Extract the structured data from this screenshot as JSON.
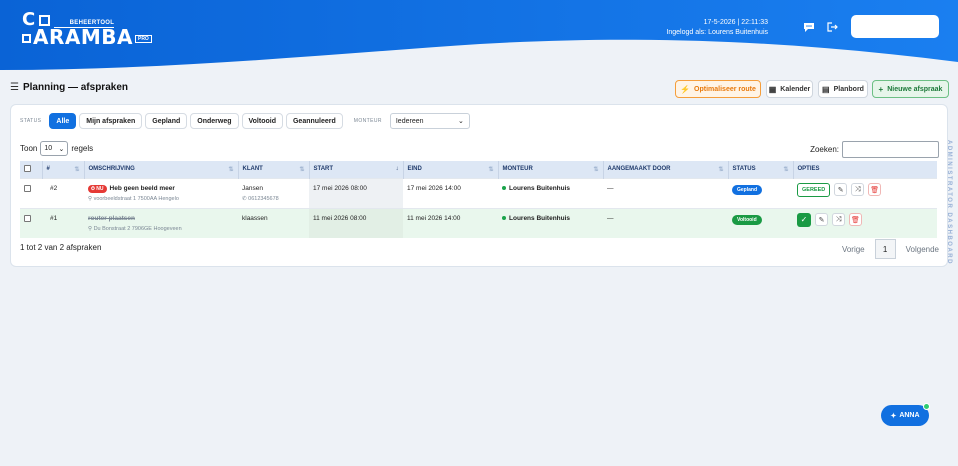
{
  "header": {
    "brand_sub": "BEHEERTOOL",
    "brand_word": "ARAMBA",
    "brand_c": "C",
    "brand_pro": "PRO",
    "datetime": "17-5-2026 | 22:11:33",
    "login": "Ingelogd als: Lourens Buitenhuis",
    "chat_icon": "chat-icon",
    "logout_icon": "logout-icon"
  },
  "page": {
    "title": "Planning — afspraken",
    "buttons": {
      "optimize": "Optimaliseer route",
      "calendar": "Kalender",
      "planbord": "Planbord",
      "new": "Nieuwe afspraak"
    }
  },
  "filters": {
    "status_label": "STATUS",
    "chips": [
      "Alle",
      "Mijn afspraken",
      "Gepland",
      "Onderweg",
      "Voltooid",
      "Geannuleerd"
    ],
    "monteur_label": "MONTEUR",
    "monteur_value": "Iedereen"
  },
  "table_controls": {
    "show_prefix": "Toon",
    "show_value": "10",
    "show_suffix": "regels",
    "search_label": "Zoeken:"
  },
  "table": {
    "columns": [
      "#",
      "OMSCHRIJVING",
      "KLANT",
      "START",
      "EIND",
      "MONTEUR",
      "AANGEMAAKT DOOR",
      "STATUS",
      "OPTIES"
    ],
    "rows": [
      {
        "id": "#2",
        "badge": "NU",
        "description": "Heb geen beeld meer",
        "address": "voorbeeldstraat 1 7500AA Hengelo",
        "client": "Jansen",
        "phone": "0612345678",
        "start": "17 mei 2026 08:00",
        "end": "17 mei 2026 14:00",
        "monteur": "Lourens Buitenhuis",
        "created_by": "—",
        "status": "Gepland",
        "action": "GEREED"
      },
      {
        "id": "#1",
        "description": "router plaatsen",
        "address": "Du Bonstraat 2 7906GE Hoogeveen",
        "client": "klaassen",
        "start": "11 mei 2026 08:00",
        "end": "11 mei 2026 14:00",
        "monteur": "Lourens Buitenhuis",
        "created_by": "—",
        "status": "Voltooid"
      }
    ]
  },
  "footer": {
    "info": "1 tot 2 van 2 afspraken",
    "prev": "Vorige",
    "page": "1",
    "next": "Volgende"
  },
  "side_label": "ADMINISTRATOR DASHBOARD",
  "assistant": "ANNA",
  "colors": {
    "primary": "#1170e0",
    "success": "#1a9a44",
    "warning": "#f59e3b",
    "danger": "#e53935"
  }
}
